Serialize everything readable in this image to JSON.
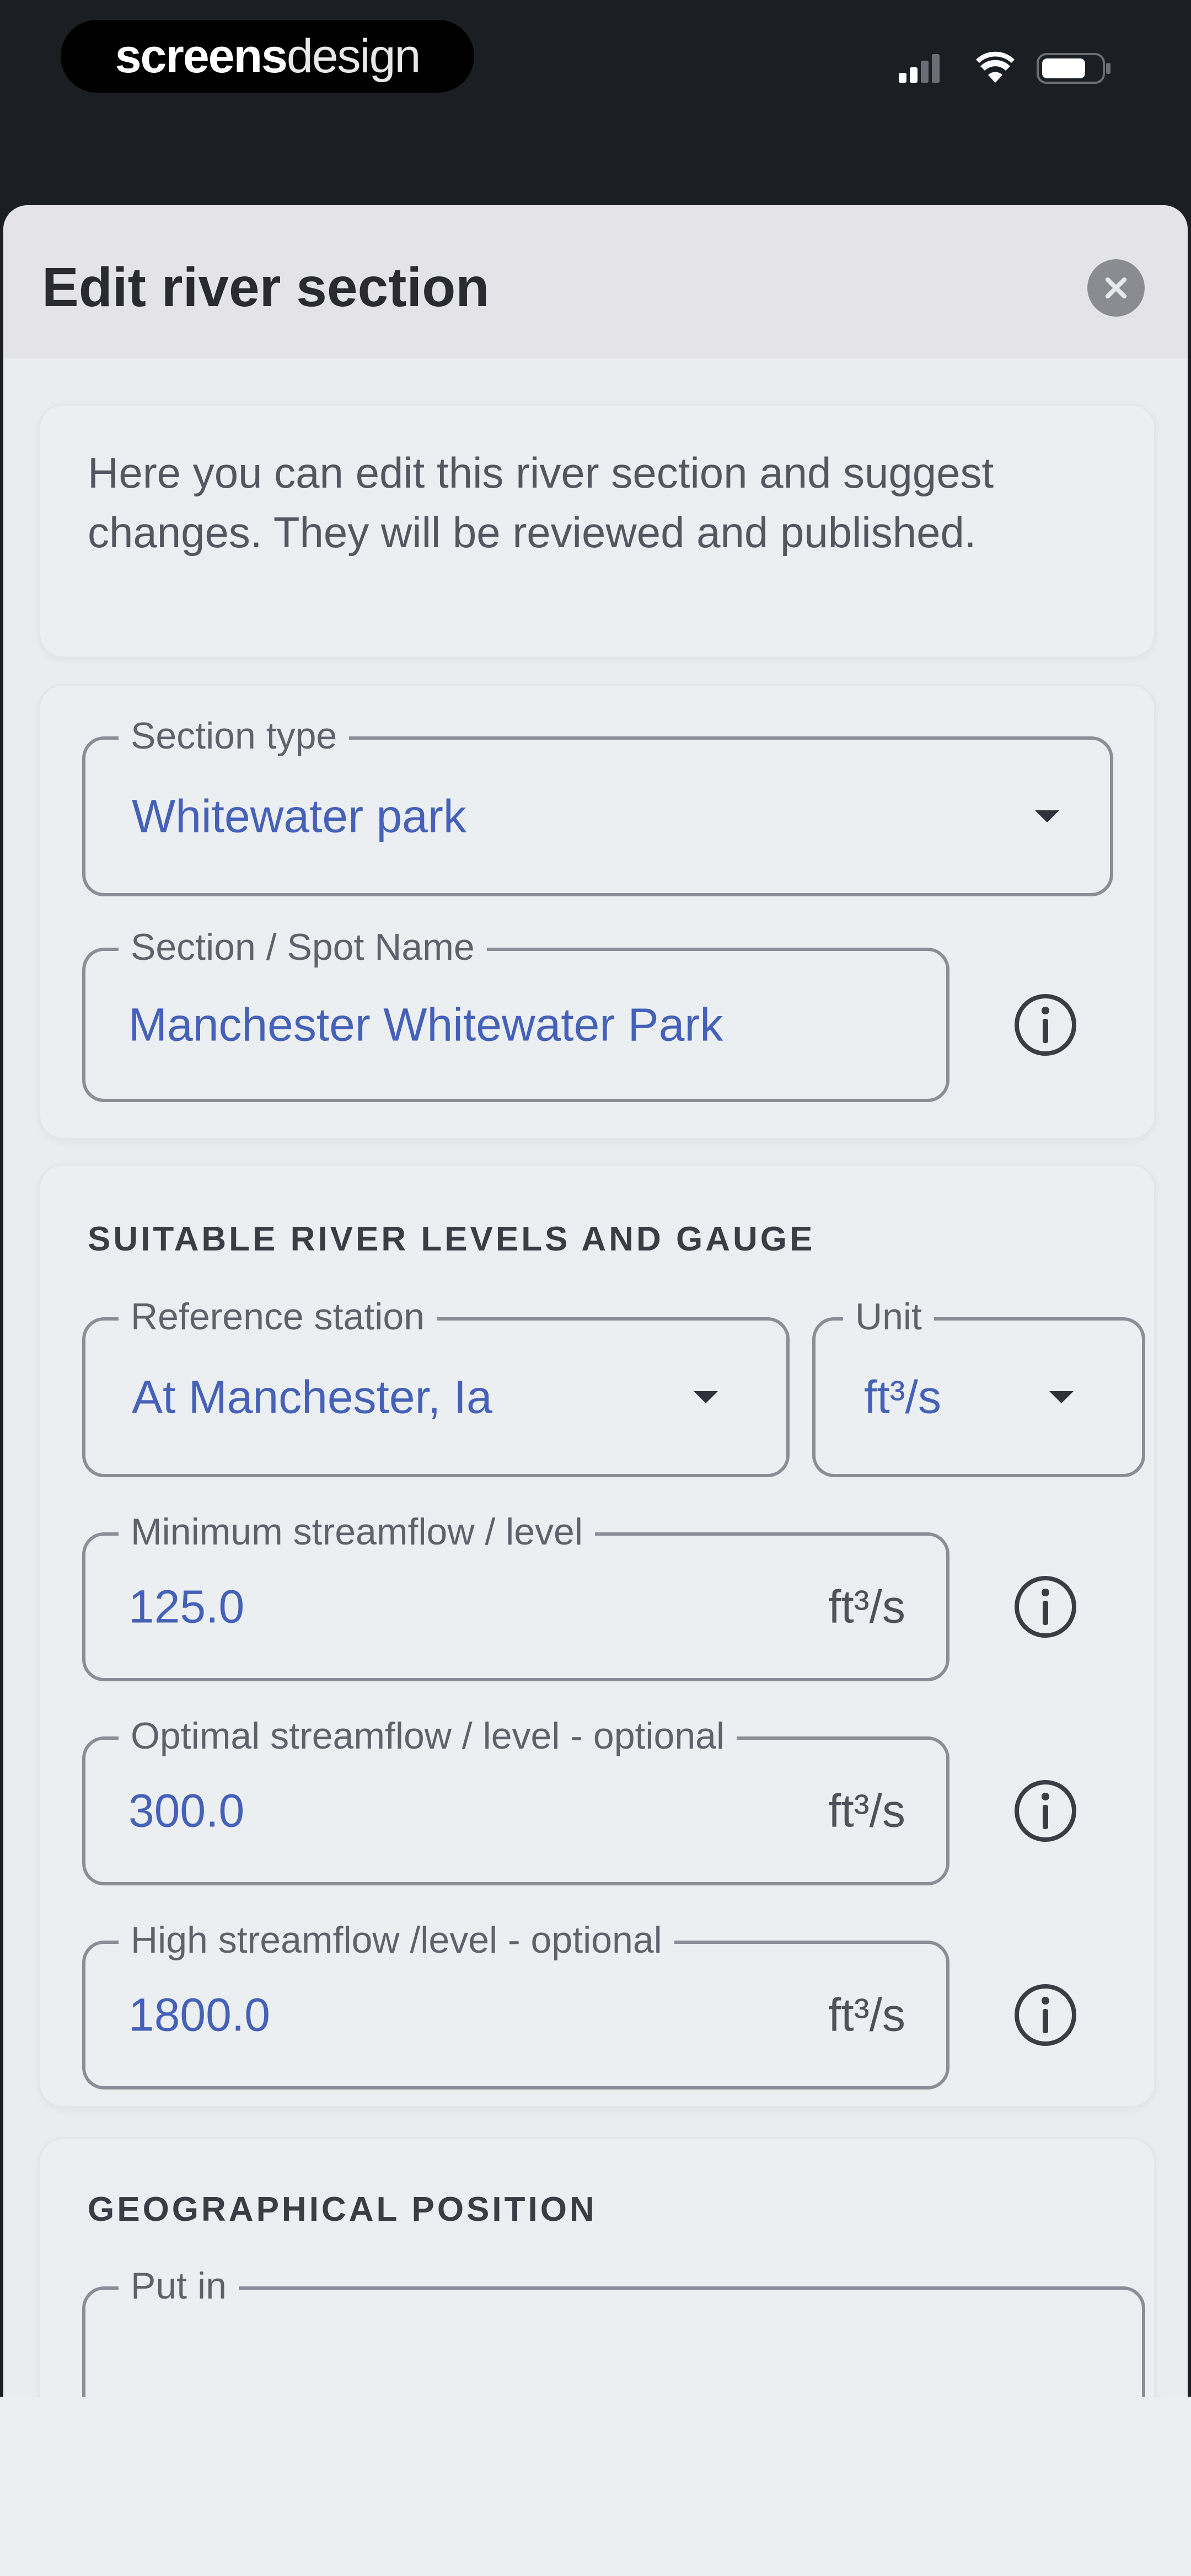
{
  "status_bar": {
    "logo_bold": "screens",
    "logo_light": "design",
    "icons": [
      "signal-icon",
      "wifi-icon",
      "battery-icon"
    ]
  },
  "sheet": {
    "title": "Edit river section",
    "close_icon": "close-icon",
    "intro": "Here you can edit this river section and suggest changes. They will be reviewed and published."
  },
  "section_details": {
    "section_type": {
      "label": "Section type",
      "value": "Whitewater park"
    },
    "spot_name": {
      "label": "Section / Spot Name",
      "value": "Manchester Whitewater Park"
    }
  },
  "levels": {
    "heading": "SUITABLE RIVER LEVELS AND GAUGE",
    "reference_station": {
      "label": "Reference station",
      "value": "At Manchester, Ia"
    },
    "unit": {
      "label": "Unit",
      "value": "ft³/s"
    },
    "minimum": {
      "label": "Minimum streamflow / level",
      "value": "125.0",
      "unit": "ft³/s"
    },
    "optimal": {
      "label": "Optimal streamflow / level - optional",
      "value": "300.0",
      "unit": "ft³/s"
    },
    "high": {
      "label": "High streamflow /level - optional",
      "value": "1800.0",
      "unit": "ft³/s"
    }
  },
  "geo": {
    "heading": "GEOGRAPHICAL POSITION",
    "put_in": {
      "label": "Put in"
    }
  },
  "colors": {
    "accent_value": "#4561b8",
    "sheet_bg": "#e9edf0",
    "status_bg": "#1b1f23"
  }
}
